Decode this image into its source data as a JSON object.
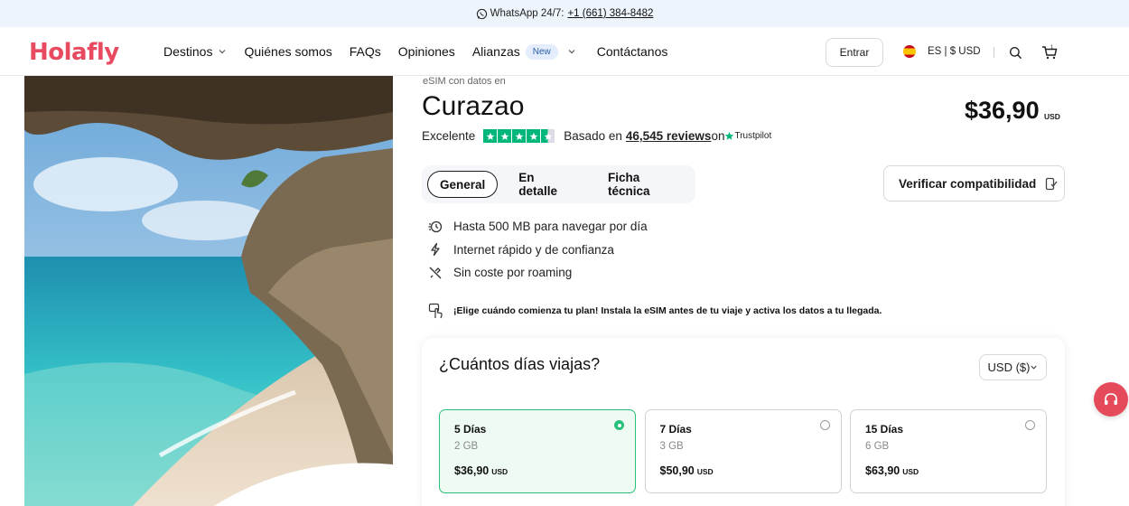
{
  "topbar": {
    "whatsapp_label": "WhatsApp 24/7:",
    "phone": "+1 (661) 384-8482"
  },
  "header": {
    "logo": "Holafly",
    "nav": [
      "Destinos",
      "Quiénes somos",
      "FAQs",
      "Opiniones",
      "Alianzas",
      "Contáctanos"
    ],
    "new_badge": "New",
    "login": "Entrar",
    "lang_currency": "ES | $ USD"
  },
  "product": {
    "subtitle": "eSIM con datos en",
    "title": "Curazao",
    "price": "$36,90",
    "price_currency": "USD",
    "rating_label": "Excelente",
    "rating_text": "Basado en",
    "reviews": "46,545 reviews",
    "on": "on",
    "trustpilot": "Trustpilot",
    "stars": 4.5
  },
  "tabs": [
    "General",
    "En detalle",
    "Ficha técnica"
  ],
  "verify_button": "Verificar compatibilidad",
  "features": [
    "Hasta 500 MB para navegar por día",
    "Internet rápido y de confianza",
    "Sin coste por roaming"
  ],
  "notice": "¡Elige cuándo comienza tu plan! Instala la eSIM antes de tu viaje y activa los datos a tu llegada.",
  "plans_section": {
    "question": "¿Cuántos días viajas?",
    "currency_select": "USD ($)",
    "plans": [
      {
        "name": "5 Días",
        "data": "2 GB",
        "price": "$36,90",
        "currency": "USD",
        "selected": true
      },
      {
        "name": "7 Días",
        "data": "3 GB",
        "price": "$50,90",
        "currency": "USD",
        "selected": false
      },
      {
        "name": "15 Días",
        "data": "6 GB",
        "price": "$63,90",
        "currency": "USD",
        "selected": false
      }
    ]
  },
  "colors": {
    "brand": "#e84a5f",
    "tp_green": "#00b67a",
    "selected_green": "#29c07b"
  }
}
